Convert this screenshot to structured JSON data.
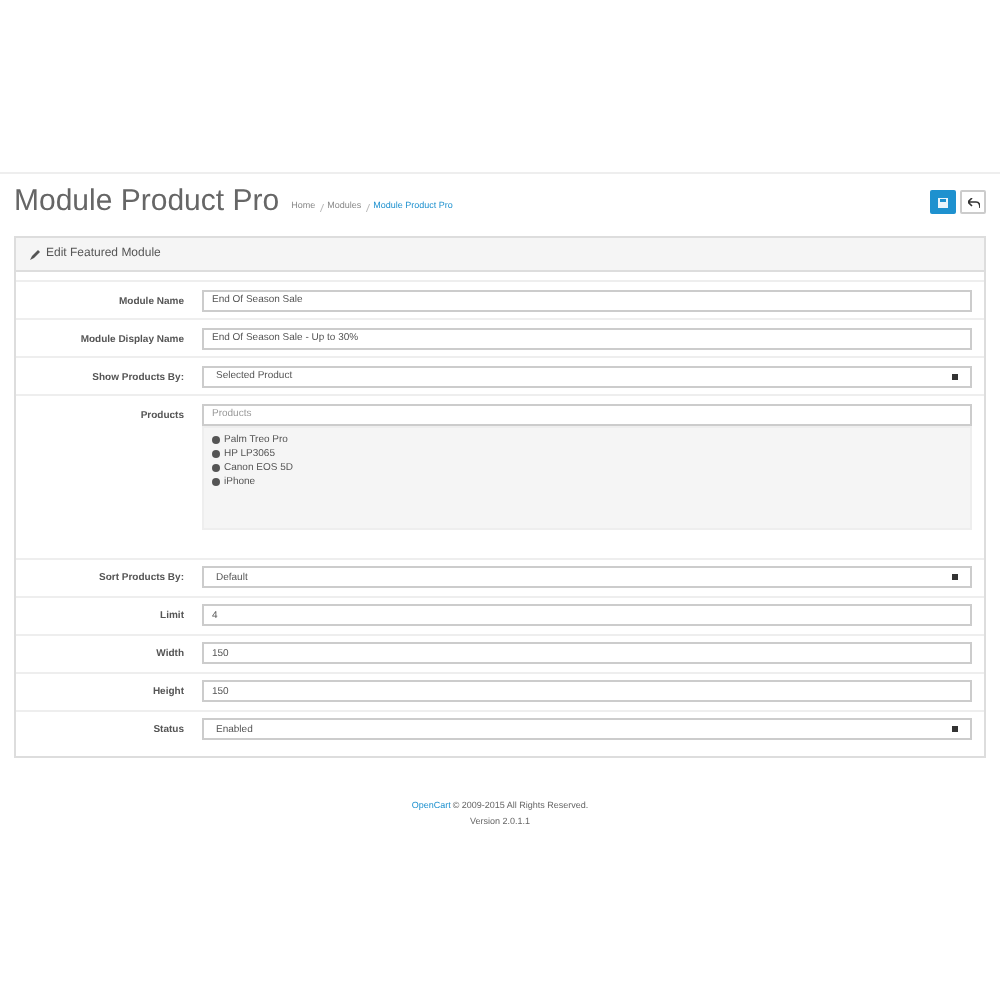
{
  "header": {
    "title": "Module Product Pro",
    "breadcrumb": [
      {
        "label": "Home",
        "current": false
      },
      {
        "label": "Modules",
        "current": false
      },
      {
        "label": "Module Product Pro",
        "current": true
      }
    ]
  },
  "panel": {
    "title": "Edit Featured Module"
  },
  "fields": [
    {
      "kind": "text",
      "label": "Module Name",
      "value": "End Of Season Sale"
    },
    {
      "kind": "text",
      "label": "Module Display Name",
      "value": "End Of Season Sale - Up to 30%"
    },
    {
      "kind": "select",
      "label": "Show Products By:",
      "value": "Selected Product"
    },
    {
      "kind": "products",
      "label": "Products",
      "placeholder": "Products",
      "items": [
        "Palm Treo Pro",
        "HP LP3065",
        "Canon EOS 5D",
        "iPhone"
      ]
    },
    {
      "kind": "select",
      "label": "Sort Products By:",
      "value": "Default"
    },
    {
      "kind": "text",
      "label": "Limit",
      "value": "4"
    },
    {
      "kind": "text",
      "label": "Width",
      "value": "150"
    },
    {
      "kind": "text",
      "label": "Height",
      "value": "150"
    },
    {
      "kind": "select",
      "label": "Status",
      "value": "Enabled"
    }
  ],
  "footer": {
    "link": "OpenCart",
    "copyright": "© 2009-2015 All Rights Reserved.",
    "version": "Version 2.0.1.1"
  }
}
